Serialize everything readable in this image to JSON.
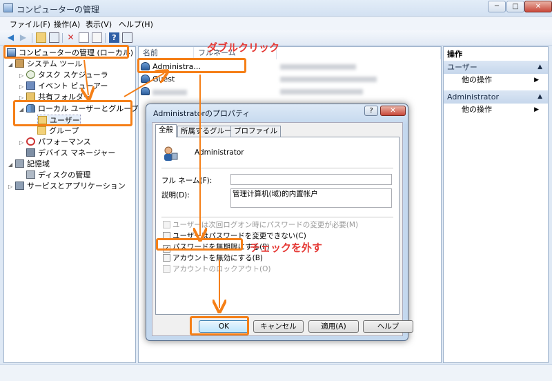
{
  "window": {
    "title": "コンピューターの管理",
    "controls": {
      "minimize": "─",
      "maximize": "□",
      "close": "✕"
    }
  },
  "menu": {
    "items": [
      "ファイル(F)",
      "操作(A)",
      "表示(V)",
      "ヘルプ(H)"
    ]
  },
  "toolbar": {
    "buttons": [
      "back-icon",
      "forward-icon",
      "up-folder-icon",
      "show-hide-tree-icon",
      "delete-icon",
      "properties-icon",
      "export-icon",
      "help-icon",
      "show-action-pane-icon"
    ]
  },
  "tree": {
    "root": "コンピューターの管理 (ローカル)",
    "system_tools": "システム ツール",
    "task_scheduler": "タスク スケジューラ",
    "event_viewer": "イベント ビューアー",
    "shared_folders": "共有フォルダー",
    "local_users_groups": "ローカル ユーザーとグループ",
    "users": "ユーザー",
    "groups": "グループ",
    "performance": "パフォーマンス",
    "device_manager": "デバイス マネージャー",
    "storage": "記憶域",
    "disk_management": "ディスクの管理",
    "services_apps": "サービスとアプリケーション"
  },
  "list": {
    "columns": [
      "名前",
      "フルネーム"
    ],
    "rows": [
      {
        "name": "Administra..."
      },
      {
        "name": "Guest"
      }
    ]
  },
  "actions": {
    "header": "操作",
    "sections": [
      {
        "title": "ユーザー",
        "item": "他の操作"
      },
      {
        "title": "Administrator",
        "item": "他の操作"
      }
    ]
  },
  "dialog": {
    "title": "Administratorのプロパティ",
    "help_btn": "?",
    "close_btn": "✕",
    "tabs": [
      "全般",
      "所属するグループ",
      "プロファイル"
    ],
    "account_name": "Administrator",
    "fullname_label": "フル ネーム(F):",
    "fullname_value": "",
    "description_label": "説明(D):",
    "description_value": "管理计算机(域)的内置帐户",
    "checkboxes": [
      {
        "label": "ユーザーは次回ログオン時にパスワードの変更が必要(M)",
        "checked": false,
        "enabled": false
      },
      {
        "label": "ユーザーはパスワードを変更できない(C)",
        "checked": false,
        "enabled": true
      },
      {
        "label": "パスワードを無期限にする(P)",
        "checked": true,
        "enabled": true
      },
      {
        "label": "アカウントを無効にする(B)",
        "checked": false,
        "enabled": true
      },
      {
        "label": "アカウントのロックアウト(O)",
        "checked": false,
        "enabled": false
      }
    ],
    "buttons": {
      "ok": "OK",
      "cancel": "キャンセル",
      "apply": "適用(A)",
      "help": "ヘルプ"
    }
  },
  "annotations": {
    "double_click": "ダブルクリック",
    "uncheck": "チェックを外す",
    "color": "#f57f17",
    "text_color": "#e53935"
  }
}
